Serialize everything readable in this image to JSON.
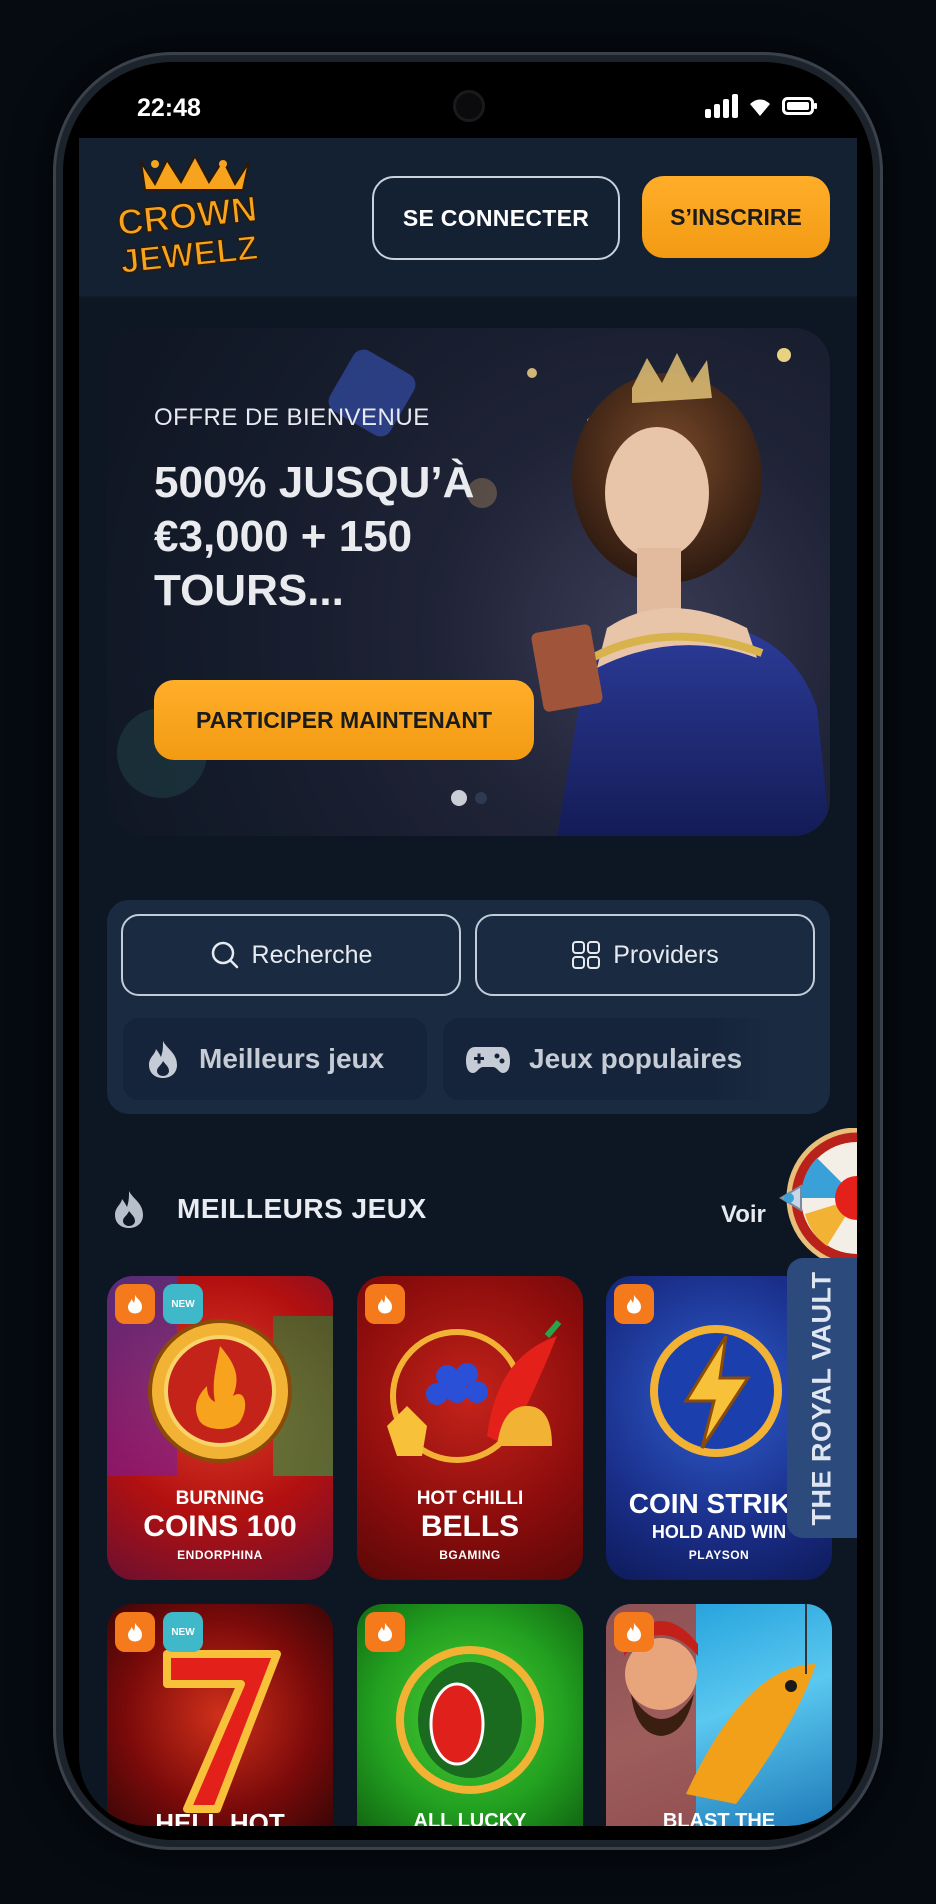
{
  "status_bar": {
    "time": "22:48"
  },
  "header": {
    "logo_text_line1": "CROWN",
    "logo_text_line2": "JEWELZ",
    "login_label": "SE CONNECTER",
    "signup_label": "S’INSCRIRE"
  },
  "banner": {
    "kicker": "OFFRE DE BIENVENUE",
    "title": "500% JUSQU’À €3,000 + 150 TOURS...",
    "cta_label": "PARTICIPER MAINTENANT",
    "slides": 2,
    "active_slide": 1
  },
  "filters": {
    "search_label": "Recherche",
    "providers_label": "Providers",
    "chips": [
      {
        "label": "Meilleurs jeux",
        "icon": "flame-icon"
      },
      {
        "label": "Jeux populaires",
        "icon": "gamepad-icon"
      }
    ]
  },
  "section": {
    "title": "MEILLEURS JEUX",
    "see_all_label": "Voir"
  },
  "games": [
    {
      "line1": "BURNING",
      "line2": "COINS 100",
      "provider": "ENDORPHINA",
      "hot": true,
      "new": true
    },
    {
      "line1": "HOT CHILLI",
      "line2": "BELLS",
      "provider": "BGAMING",
      "hot": true,
      "new": false
    },
    {
      "line1": "COIN STRIKE",
      "line2": "HOLD AND WIN",
      "provider": "PLAYSON",
      "hot": true,
      "new": false
    },
    {
      "line1": "HELL HOT",
      "line2": "",
      "provider": "",
      "hot": true,
      "new": true
    },
    {
      "line1": "ALL LUCKY",
      "line2": "",
      "provider": "",
      "hot": true,
      "new": false
    },
    {
      "line1": "BLAST THE",
      "line2": "",
      "provider": "",
      "hot": true,
      "new": false
    }
  ],
  "badges": {
    "new_label": "NEW"
  },
  "vault": {
    "label": "THE ROYAL VAULT"
  },
  "colors": {
    "accent": "#f7a31d",
    "background": "#0d1623",
    "panel": "#1a2a40",
    "hot_badge": "#f47a1c",
    "new_badge": "#3fb8c9"
  }
}
